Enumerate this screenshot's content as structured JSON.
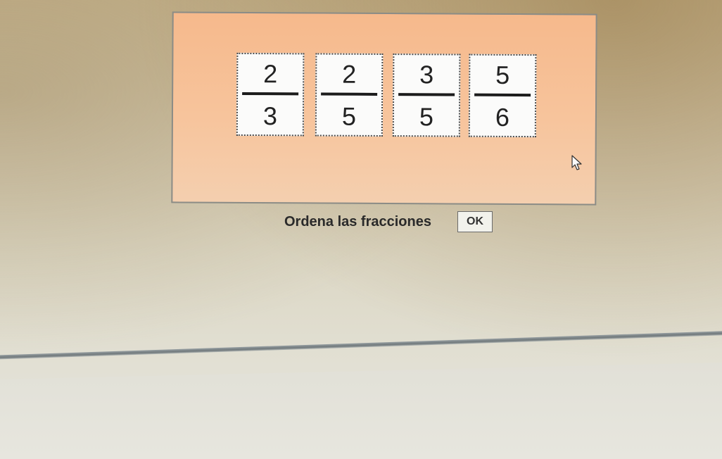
{
  "exercise": {
    "fractions": [
      {
        "numerator": "2",
        "denominator": "3"
      },
      {
        "numerator": "2",
        "denominator": "5"
      },
      {
        "numerator": "3",
        "denominator": "5"
      },
      {
        "numerator": "5",
        "denominator": "6"
      }
    ]
  },
  "footer": {
    "prompt": "Ordena las fracciones",
    "ok_label": "OK"
  },
  "icons": {
    "cursor": "mouse-pointer-icon"
  }
}
